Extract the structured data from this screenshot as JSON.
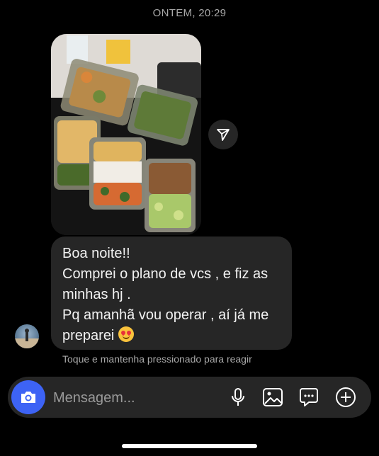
{
  "thread": {
    "timestamp": "ONTEM, 20:29"
  },
  "message": {
    "lines": [
      "Boa noite!!",
      "Comprei o plano de vcs , e fiz as",
      "minhas hj .",
      "Pq amanhã vou operar , aí já me",
      "preparei"
    ],
    "reaction_hint": "Toque e mantenha pressionado para reagir"
  },
  "composer": {
    "placeholder": "Mensagem...",
    "icons": [
      "camera-icon",
      "microphone-icon",
      "gallery-icon",
      "sticker-icon",
      "plus-icon"
    ]
  },
  "colors": {
    "background": "#000000",
    "bubble": "#262626",
    "accent": "#3d63f5",
    "secondary_text": "#a8a8a8"
  }
}
